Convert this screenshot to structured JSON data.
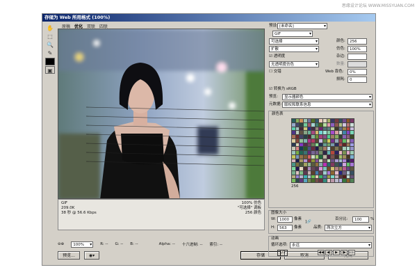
{
  "title": "存储为 Web 所用格式 (100%)",
  "tabs": [
    "原稿",
    "优化",
    "双联",
    "四联"
  ],
  "info": {
    "format": "GIF",
    "size": "209.0K",
    "time": "38 秒 @ 56.6 Kbps",
    "quality": "100% 仿色",
    "palette": "\"可选择\" 调板",
    "colors": "256 颜色"
  },
  "status": {
    "zoom": "100%",
    "r": "R: --",
    "g": "G: --",
    "b": "B: --",
    "alpha": "Alpha: --",
    "hex": "十六进制: --",
    "index": "索引: --"
  },
  "settings": {
    "preset_label": "预设:",
    "preset": "[未命名]",
    "format": "GIF",
    "reduction": "可选择",
    "dither_algo": "扩散",
    "transparency": "透明度",
    "matte_dither": "无透明度仿色",
    "interlaced": "交错",
    "colors_label": "颜色:",
    "colors": "256",
    "dither_label": "仿色:",
    "dither": "100%",
    "matte_label": "杂边:",
    "amount_label": "数量:",
    "web_snap_label": "Web 靠色:",
    "web_snap": "0%",
    "lossy_label": "损耗:",
    "lossy": "0"
  },
  "srgb": {
    "label": "转换为 sRGB",
    "preview_label": "预览:",
    "preview": "显示器颜色",
    "metadata_label": "元数据:",
    "metadata": "版权和联系信息"
  },
  "color_table": {
    "title": "颜色表",
    "count": "256"
  },
  "image_size": {
    "title": "图像大小",
    "w_label": "W:",
    "w": "1000",
    "h_label": "H:",
    "h": "563",
    "unit": "像素",
    "percent_label": "百分比:",
    "percent": "100",
    "percent_unit": "%",
    "quality_label": "品质:",
    "quality": "两次立方"
  },
  "animation": {
    "title": "动画",
    "loop_label": "循环选项:",
    "loop": "永远",
    "frame": "1/1",
    "nav": [
      "◀◀",
      "◀|",
      "▶",
      "|▶",
      "▶▶"
    ]
  },
  "buttons": {
    "preview": "预览...",
    "save": "存储",
    "cancel": "取消",
    "done": "完成"
  },
  "watermark": "思缘设计论坛 WWW.MISSYUAN.COM"
}
